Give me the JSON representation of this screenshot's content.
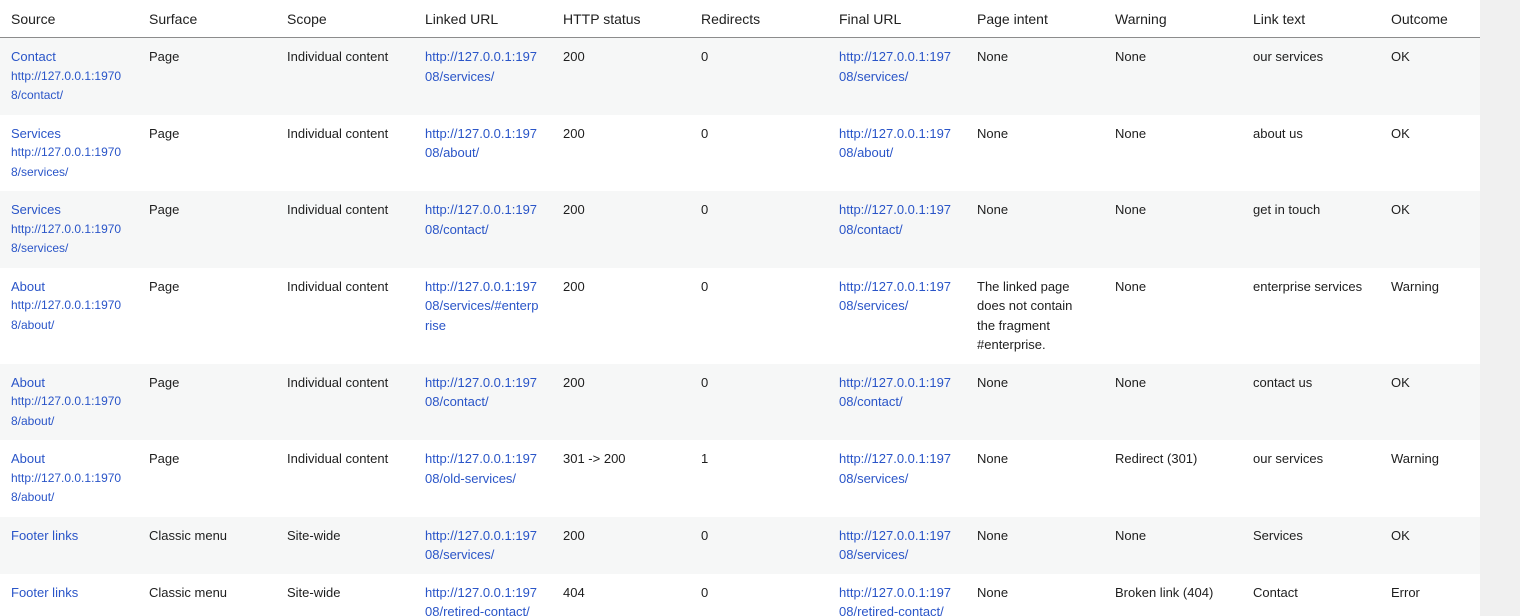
{
  "columns": [
    "Source",
    "Surface",
    "Scope",
    "Linked URL",
    "HTTP status",
    "Redirects",
    "Final URL",
    "Page intent",
    "Warning",
    "Link text",
    "Outcome"
  ],
  "rows": [
    {
      "source_title": "Contact",
      "source_url": "http://127.0.0.1:19708/contact/",
      "surface": "Page",
      "scope": "Individual content",
      "linked_url": "http://127.0.0.1:19708/services/",
      "http_status": "200",
      "redirects": "0",
      "final_url": "http://127.0.0.1:19708/services/",
      "page_intent": "None",
      "warning": "None",
      "link_text": "our services",
      "outcome": "OK"
    },
    {
      "source_title": "Services",
      "source_url": "http://127.0.0.1:19708/services/",
      "surface": "Page",
      "scope": "Individual content",
      "linked_url": "http://127.0.0.1:19708/about/",
      "http_status": "200",
      "redirects": "0",
      "final_url": "http://127.0.0.1:19708/about/",
      "page_intent": "None",
      "warning": "None",
      "link_text": "about us",
      "outcome": "OK"
    },
    {
      "source_title": "Services",
      "source_url": "http://127.0.0.1:19708/services/",
      "surface": "Page",
      "scope": "Individual content",
      "linked_url": "http://127.0.0.1:19708/contact/",
      "http_status": "200",
      "redirects": "0",
      "final_url": "http://127.0.0.1:19708/contact/",
      "page_intent": "None",
      "warning": "None",
      "link_text": "get in touch",
      "outcome": "OK"
    },
    {
      "source_title": "About",
      "source_url": "http://127.0.0.1:19708/about/",
      "surface": "Page",
      "scope": "Individual content",
      "linked_url": "http://127.0.0.1:19708/services/#enterprise",
      "http_status": "200",
      "redirects": "0",
      "final_url": "http://127.0.0.1:19708/services/",
      "page_intent": "The linked page does not contain the fragment #enterprise.",
      "warning": "None",
      "link_text": "enterprise services",
      "outcome": "Warning"
    },
    {
      "source_title": "About",
      "source_url": "http://127.0.0.1:19708/about/",
      "surface": "Page",
      "scope": "Individual content",
      "linked_url": "http://127.0.0.1:19708/contact/",
      "http_status": "200",
      "redirects": "0",
      "final_url": "http://127.0.0.1:19708/contact/",
      "page_intent": "None",
      "warning": "None",
      "link_text": "contact us",
      "outcome": "OK"
    },
    {
      "source_title": "About",
      "source_url": "http://127.0.0.1:19708/about/",
      "surface": "Page",
      "scope": "Individual content",
      "linked_url": "http://127.0.0.1:19708/old-services/",
      "http_status": "301 -> 200",
      "redirects": "1",
      "final_url": "http://127.0.0.1:19708/services/",
      "page_intent": "None",
      "warning": "Redirect (301)",
      "link_text": "our services",
      "outcome": "Warning"
    },
    {
      "source_title": "Footer links",
      "source_url": "",
      "surface": "Classic menu",
      "scope": "Site-wide",
      "linked_url": "http://127.0.0.1:19708/services/",
      "http_status": "200",
      "redirects": "0",
      "final_url": "http://127.0.0.1:19708/services/",
      "page_intent": "None",
      "warning": "None",
      "link_text": "Services",
      "outcome": "OK"
    },
    {
      "source_title": "Footer links",
      "source_url": "",
      "surface": "Classic menu",
      "scope": "Site-wide",
      "linked_url": "http://127.0.0.1:19708/retired-contact/",
      "http_status": "404",
      "redirects": "0",
      "final_url": "http://127.0.0.1:19708/retired-contact/",
      "page_intent": "None",
      "warning": "Broken link (404)",
      "link_text": "Contact",
      "outcome": "Error"
    }
  ],
  "colors": {
    "link": "#2a55c8",
    "row_alt": "#f6f7f7",
    "header_border": "#8c8c8c"
  }
}
